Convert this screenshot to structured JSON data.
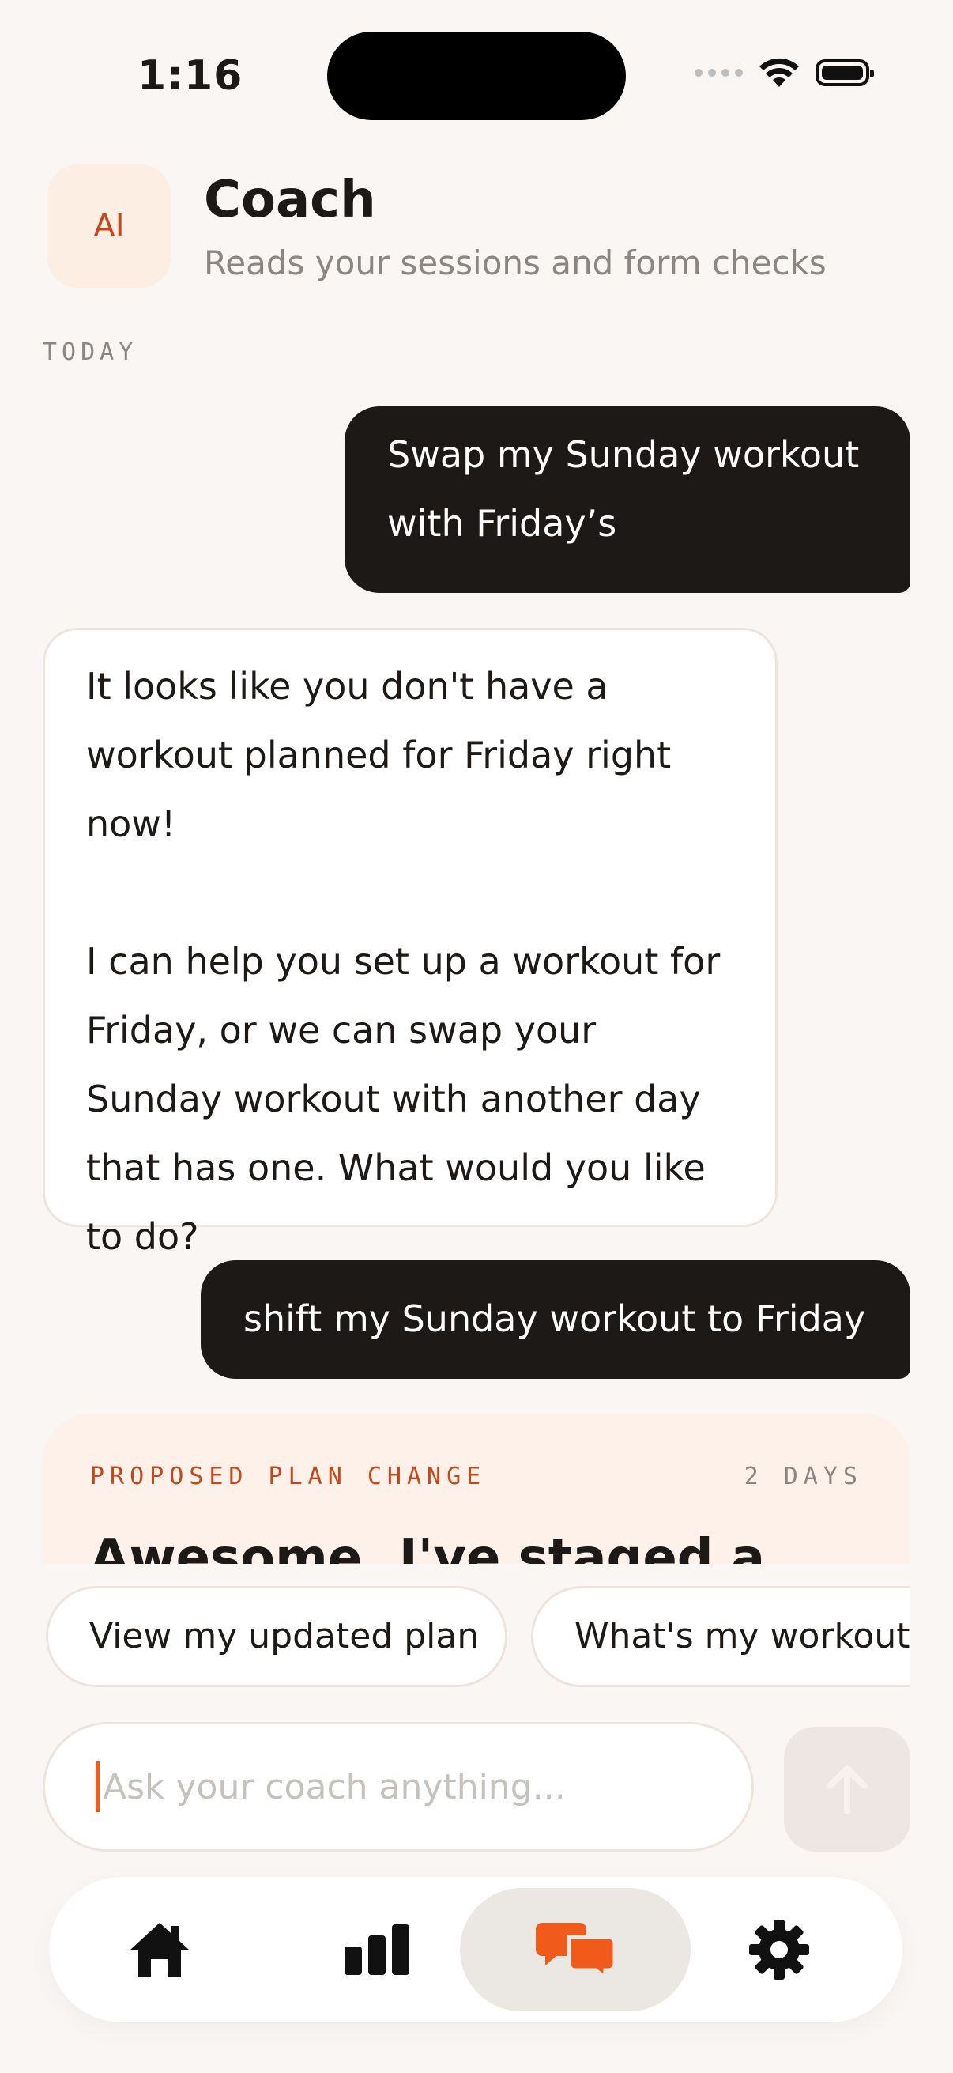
{
  "status_bar": {
    "time": "1:16"
  },
  "header": {
    "avatar_text": "AI",
    "title": "Coach",
    "subtitle": "Reads your sessions and form checks"
  },
  "day_label": "TODAY",
  "messages": [
    {
      "role": "user",
      "text": "Swap my Sunday workout with Friday’s"
    },
    {
      "role": "assistant",
      "paragraphs": [
        "It looks like you don't have a workout planned for Friday right now!",
        "I can help you set up a workout for Friday, or we can swap your Sunday workout with another day that has one. What would you like to do?"
      ]
    },
    {
      "role": "user",
      "text": "shift my Sunday workout to Friday"
    }
  ],
  "proposal": {
    "label": "PROPOSED PLAN CHANGE",
    "days": "2 DAYS",
    "headline": "Awesome, I've staged a"
  },
  "suggestions": [
    "View my updated plan",
    "What's my workout t"
  ],
  "composer": {
    "placeholder": "Ask your coach anything..."
  },
  "tabs": [
    {
      "name": "home",
      "icon": "home-icon",
      "active": false
    },
    {
      "name": "stats",
      "icon": "bar-chart-icon",
      "active": false
    },
    {
      "name": "chat",
      "icon": "chat-bubbles-icon",
      "active": true
    },
    {
      "name": "settings",
      "icon": "gear-icon",
      "active": false
    }
  ],
  "colors": {
    "background": "#FAF6F3",
    "accent": "#F05A1A",
    "user_bubble": "#1C1916",
    "assistant_bubble": "#FFFFFF",
    "proposal_bg": "#FEF1EA"
  }
}
